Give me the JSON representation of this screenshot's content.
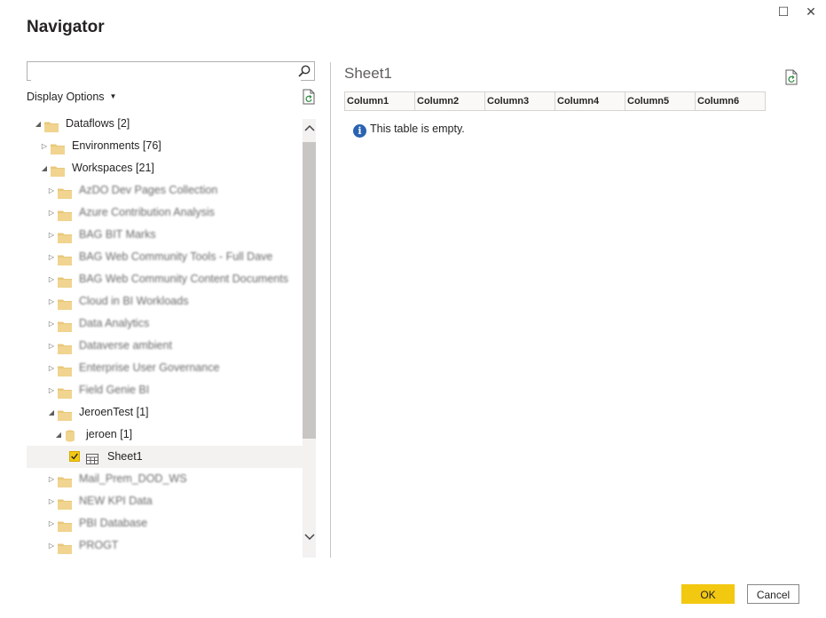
{
  "window": {
    "title": "Navigator",
    "maximize_glyph": "☐",
    "close_glyph": "✕"
  },
  "left": {
    "search": {
      "value": "",
      "placeholder": ""
    },
    "display_options": {
      "label": "Display Options"
    },
    "tree": [
      {
        "label": "Dataflows [2]",
        "level": 0,
        "expander": "expanded",
        "icon": "folder-icon"
      },
      {
        "label": "Environments [76]",
        "level": 1,
        "expander": "collapsed",
        "icon": "folder-icon"
      },
      {
        "label": "Workspaces [21]",
        "level": 1,
        "expander": "expanded",
        "icon": "folder-icon"
      },
      {
        "label": "AzDO Dev Pages Collection",
        "level": 2,
        "expander": "collapsed",
        "icon": "folder-icon",
        "blurred": true
      },
      {
        "label": "Azure Contribution Analysis",
        "level": 2,
        "expander": "collapsed",
        "icon": "folder-icon",
        "blurred": true
      },
      {
        "label": "BAG BIT Marks",
        "level": 2,
        "expander": "collapsed",
        "icon": "folder-icon",
        "blurred": true
      },
      {
        "label": "BAG Web Community Tools - Full Dave",
        "level": 2,
        "expander": "collapsed",
        "icon": "folder-icon",
        "blurred": true
      },
      {
        "label": "BAG Web Community Content Documents",
        "level": 2,
        "expander": "collapsed",
        "icon": "folder-icon",
        "blurred": true
      },
      {
        "label": "Cloud in BI Workloads",
        "level": 2,
        "expander": "collapsed",
        "icon": "folder-icon",
        "blurred": true
      },
      {
        "label": "Data Analytics",
        "level": 2,
        "expander": "collapsed",
        "icon": "folder-icon",
        "blurred": true
      },
      {
        "label": "Dataverse ambient",
        "level": 2,
        "expander": "collapsed",
        "icon": "folder-icon",
        "blurred": true
      },
      {
        "label": "Enterprise User Governance",
        "level": 2,
        "expander": "collapsed",
        "icon": "folder-icon",
        "blurred": true
      },
      {
        "label": "Field Genie BI",
        "level": 2,
        "expander": "collapsed",
        "icon": "folder-icon",
        "blurred": true
      },
      {
        "label": "JeroenTest [1]",
        "level": 2,
        "expander": "expanded",
        "icon": "folder-icon"
      },
      {
        "label": "jeroen [1]",
        "level": 3,
        "expander": "expanded",
        "icon": "database-icon"
      },
      {
        "label": "Sheet1",
        "level": 4,
        "expander": "none",
        "icon": "table-icon",
        "checked": true,
        "selected": true
      },
      {
        "label": "Mail_Prem_DOD_WS",
        "level": 2,
        "expander": "collapsed",
        "icon": "folder-icon",
        "blurred": true
      },
      {
        "label": "NEW KPI Data",
        "level": 2,
        "expander": "collapsed",
        "icon": "folder-icon",
        "blurred": true
      },
      {
        "label": "PBI Database",
        "level": 2,
        "expander": "collapsed",
        "icon": "folder-icon",
        "blurred": true
      },
      {
        "label": "PROGT",
        "level": 2,
        "expander": "collapsed",
        "icon": "folder-icon",
        "blurred": true
      }
    ]
  },
  "right": {
    "sheet_title": "Sheet1",
    "columns": [
      "Column1",
      "Column2",
      "Column3",
      "Column4",
      "Column5",
      "Column6"
    ],
    "empty_message": "This table is empty."
  },
  "footer": {
    "ok_label": "OK",
    "cancel_label": "Cancel"
  },
  "colors": {
    "accent": "#f2c811",
    "folder": "#e8c87a",
    "info": "#2b63b3"
  }
}
